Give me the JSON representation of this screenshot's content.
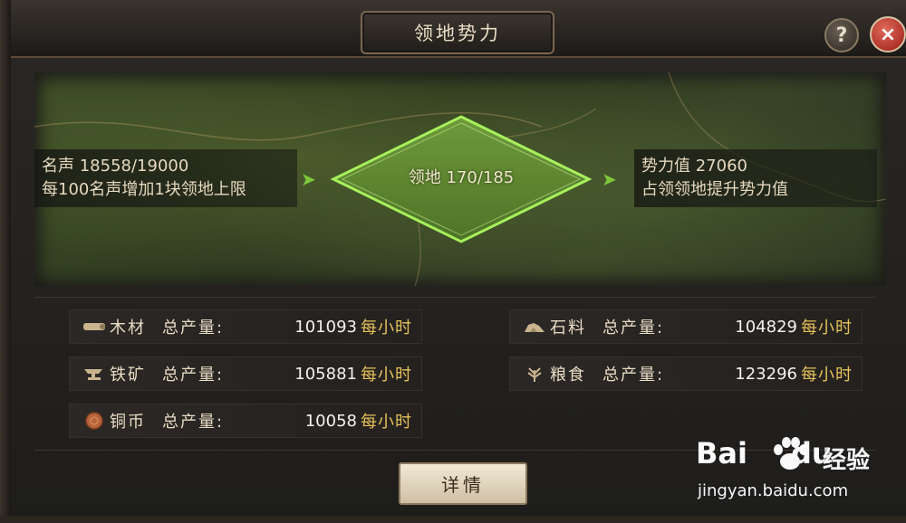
{
  "window": {
    "title": "领地势力",
    "help_label": "?",
    "close_label": "×"
  },
  "fame": {
    "line1": "名声 18558/19000",
    "line2": "每100名声增加1块领地上限"
  },
  "territory": {
    "label": "领地 170/185"
  },
  "power": {
    "line1": "势力值 27060",
    "line2": "占领领地提升势力值"
  },
  "resources": [
    {
      "name": "木材",
      "label": "总产量:",
      "value": "101093",
      "unit": "每小时",
      "icon": "wood-icon"
    },
    {
      "name": "铁矿",
      "label": "总产量:",
      "value": "105881",
      "unit": "每小时",
      "icon": "iron-anvil-icon"
    },
    {
      "name": "铜币",
      "label": "总产量:",
      "value": "10058",
      "unit": "每小时",
      "icon": "copper-coin-icon"
    },
    {
      "name": "石料",
      "label": "总产量:",
      "value": "104829",
      "unit": "每小时",
      "icon": "stone-icon"
    },
    {
      "name": "粮食",
      "label": "总产量:",
      "value": "123296",
      "unit": "每小时",
      "icon": "grain-icon"
    }
  ],
  "details_button": "详情",
  "watermark": {
    "logo": "Bai",
    "logo_suffix": "du",
    "jingyan": "经验",
    "url": "jingyan.baidu.com"
  },
  "colors": {
    "accent_green": "#7dc93a",
    "unit_gold": "#e7c25a",
    "close_red": "#b3281c"
  }
}
